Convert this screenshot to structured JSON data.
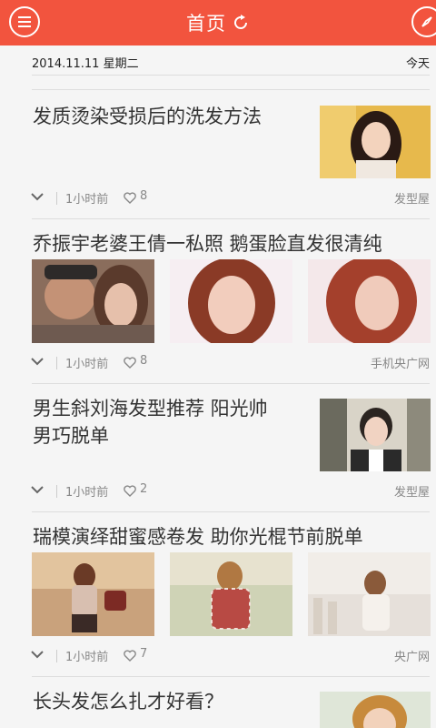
{
  "header": {
    "title": "首页",
    "menu_icon": "menu-icon",
    "refresh_icon": "refresh-icon",
    "compass_icon": "compass-icon"
  },
  "dateline": {
    "date": "2014.11.11 星期二",
    "today": "今天"
  },
  "articles": [
    {
      "title": "发质烫染受损后的洗发方法",
      "time": "1小时前",
      "likes": "8",
      "source": "发型屋"
    },
    {
      "title": "乔振宇老婆王倩一私照 鹅蛋脸直发很清纯",
      "time": "1小时前",
      "likes": "8",
      "source": "手机央广网"
    },
    {
      "title_line1": "男生斜刘海发型推荐 阳光帅",
      "title_line2": "男巧脱单",
      "time": "1小时前",
      "likes": "2",
      "source": "发型屋"
    },
    {
      "title": "瑞模演绎甜蜜感卷发 助你光棍节前脱单",
      "time": "1小时前",
      "likes": "7",
      "source": "央广网"
    },
    {
      "title": "长头发怎么扎才好看？"
    }
  ],
  "colors": {
    "accent": "#f2543e"
  }
}
